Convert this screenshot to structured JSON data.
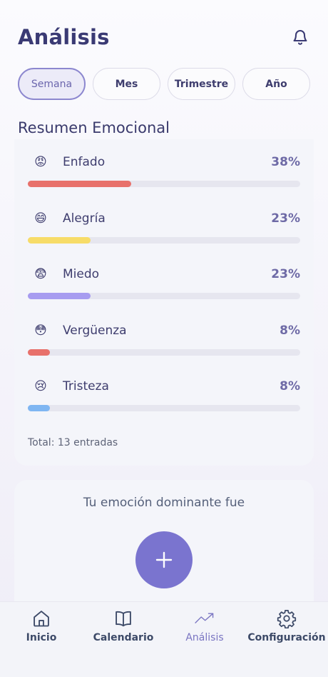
{
  "header": {
    "title": "Análisis",
    "bell_icon": "bell-icon"
  },
  "periods": [
    {
      "label": "Semana",
      "active": true
    },
    {
      "label": "Mes",
      "active": false
    },
    {
      "label": "Trimestre",
      "active": false
    },
    {
      "label": "Año",
      "active": false
    }
  ],
  "summary": {
    "title": "Resumen Emocional",
    "emotions": [
      {
        "emoji": "😡",
        "icon": "angry-face-icon",
        "label": "Enfado",
        "percent": "38%",
        "fill": 0.38,
        "color": "#e8716b"
      },
      {
        "emoji": "😄",
        "icon": "grinning-face-icon",
        "label": "Alegría",
        "percent": "23%",
        "fill": 0.23,
        "color": "#f7dc68"
      },
      {
        "emoji": "😨",
        "icon": "fearful-face-icon",
        "label": "Miedo",
        "percent": "23%",
        "fill": 0.23,
        "color": "#a79cf0"
      },
      {
        "emoji": "😳",
        "icon": "flushed-face-icon",
        "label": "Vergüenza",
        "percent": "8%",
        "fill": 0.08,
        "color": "#e8716b"
      },
      {
        "emoji": "😢",
        "icon": "crying-face-icon",
        "label": "Tristeza",
        "percent": "8%",
        "fill": 0.08,
        "color": "#7fb6f2"
      }
    ],
    "total": "Total: 13 entradas"
  },
  "dominant": {
    "text": "Tu emoción dominante fue",
    "button_icon": "plus-icon"
  },
  "nav": [
    {
      "label": "Inicio",
      "icon": "home-icon",
      "active": false
    },
    {
      "label": "Calendario",
      "icon": "book-icon",
      "active": false
    },
    {
      "label": "Análisis",
      "icon": "trend-up-icon",
      "active": true
    },
    {
      "label": "Configuración",
      "icon": "gear-icon",
      "active": false
    }
  ],
  "colors": {
    "accent": "#7a74cf",
    "title": "#3a3a74",
    "nav_active": "#7a75c2"
  }
}
